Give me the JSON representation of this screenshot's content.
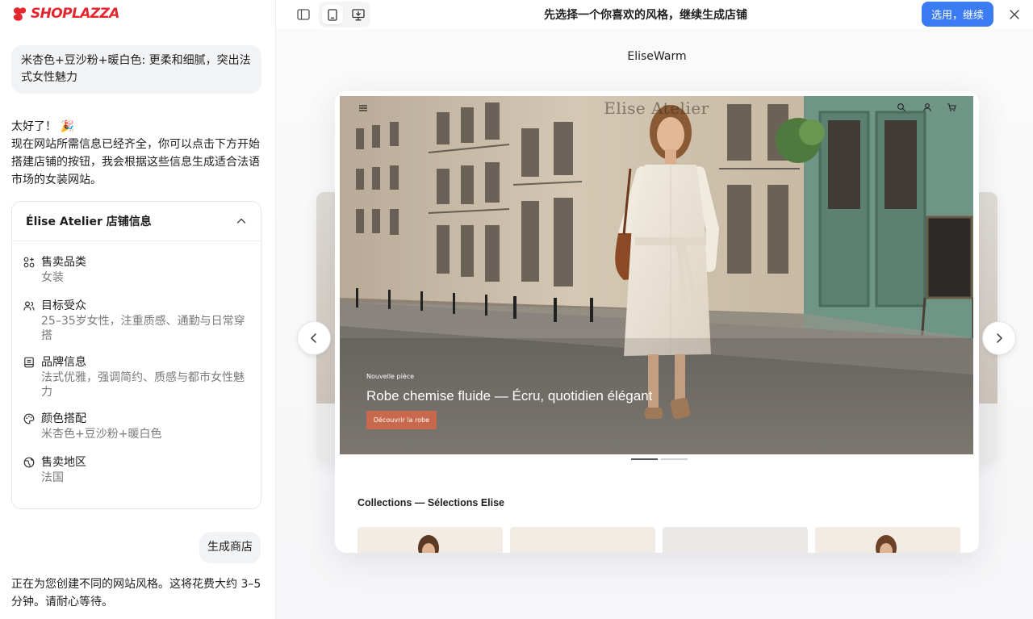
{
  "brand": {
    "logo_text": "SHOPLAZZA",
    "logo_color": "#e5262c"
  },
  "chat": {
    "user_message_1": "米杏色+豆沙粉+暖白色: 更柔和细腻，突出法式女性魅力",
    "assistant_greeting": "太好了！",
    "assistant_emoji": "🎉",
    "assistant_body": "现在网站所需信息已经齐全，你可以点击下方开始搭建店铺的按钮，我会根据这些信息生成适合法语市场的女装网站。",
    "store_card": {
      "title": "Élise Atelier 店铺信息",
      "items": [
        {
          "icon": "category-grid-icon",
          "label": "售卖品类",
          "value": "女装"
        },
        {
          "icon": "audience-users-icon",
          "label": "目标受众",
          "value": "25–35岁女性，注重质感、通勤与日常穿搭"
        },
        {
          "icon": "brand-book-icon",
          "label": "品牌信息",
          "value": "法式优雅，强调简约、质感与都市女性魅力"
        },
        {
          "icon": "palette-icon",
          "label": "颜色搭配",
          "value": "米杏色+豆沙粉+暖白色"
        },
        {
          "icon": "globe-region-icon",
          "label": "售卖地区",
          "value": "法国"
        }
      ]
    },
    "user_message_2": "生成商店",
    "assistant_waiting": "正在为您创建不同的网站风格。这将花费大约 3–5 分钟。请耐心等待。"
  },
  "topbar": {
    "title": "先选择一个你喜欢的风格，继续生成店铺",
    "select_button": "选用，继续",
    "accent_color": "#3b7cf5"
  },
  "preview": {
    "theme_name": "EliseWarm",
    "store_brand": "Elise Atelier",
    "hero": {
      "kicker": "Nouvelle pièce",
      "headline": "Robe chemise fluide — Écru, quotidien élégant",
      "cta": "Découvrir la robe",
      "cta_color": "#c8694e"
    },
    "collections_title": "Collections — Sélections Elise"
  }
}
